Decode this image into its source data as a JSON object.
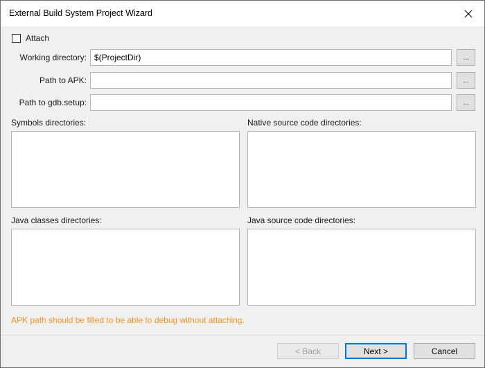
{
  "window": {
    "title": "External Build System Project Wizard",
    "close_icon": "close-icon"
  },
  "attach": {
    "label": "Attach",
    "checked": false
  },
  "fields": {
    "working_directory": {
      "label": "Working directory:",
      "value": "$(ProjectDir)",
      "browse_label": "..."
    },
    "path_to_apk": {
      "label": "Path to APK:",
      "value": "",
      "browse_label": "..."
    },
    "path_to_gdb_setup": {
      "label": "Path to gdb.setup:",
      "value": "",
      "browse_label": "..."
    }
  },
  "lists": {
    "symbols": {
      "label": "Symbols directories:"
    },
    "native_source": {
      "label": "Native source code directories:"
    },
    "java_classes": {
      "label": "Java classes directories:"
    },
    "java_source": {
      "label": "Java source code directories:"
    }
  },
  "warning": {
    "text": "APK path should be filled to be able to debug without attaching.",
    "color": "#f7931e"
  },
  "buttons": {
    "back": "< Back",
    "next": "Next >",
    "cancel": "Cancel"
  }
}
